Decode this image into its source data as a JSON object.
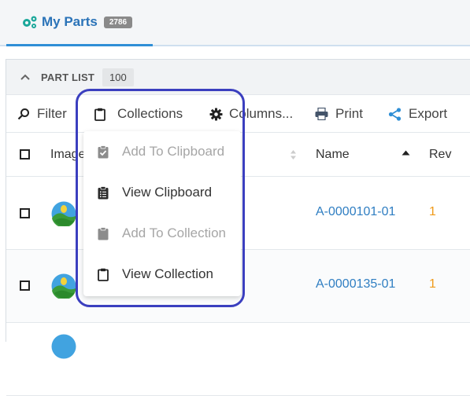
{
  "tab": {
    "label": "My Parts",
    "count": "2786",
    "icon": "gears-icon"
  },
  "panel": {
    "title": "PART LIST",
    "count": "100"
  },
  "toolbar": {
    "filter": "Filter",
    "collections": "Collections",
    "columns": "Columns...",
    "print": "Print",
    "export": "Export"
  },
  "columns": {
    "image": "Image",
    "name": "Name",
    "rev": "Rev"
  },
  "rows": [
    {
      "name": "A-0000101-01",
      "rev": "1"
    },
    {
      "name": "A-0000135-01",
      "rev": "1"
    }
  ],
  "menu": [
    {
      "label": "Add To Clipboard",
      "enabled": false,
      "icon": "clipboard-check-icon"
    },
    {
      "label": "View Clipboard",
      "enabled": true,
      "icon": "clipboard-list-icon"
    },
    {
      "label": "Add To Collection",
      "enabled": false,
      "icon": "clipboard-filled-icon"
    },
    {
      "label": "View Collection",
      "enabled": true,
      "icon": "clipboard-outline-icon"
    }
  ],
  "colors": {
    "accent": "#2f7ec2",
    "rev": "#f09a1a",
    "highlight": "#3b3fbf",
    "disabled": "#a6a6a6"
  }
}
